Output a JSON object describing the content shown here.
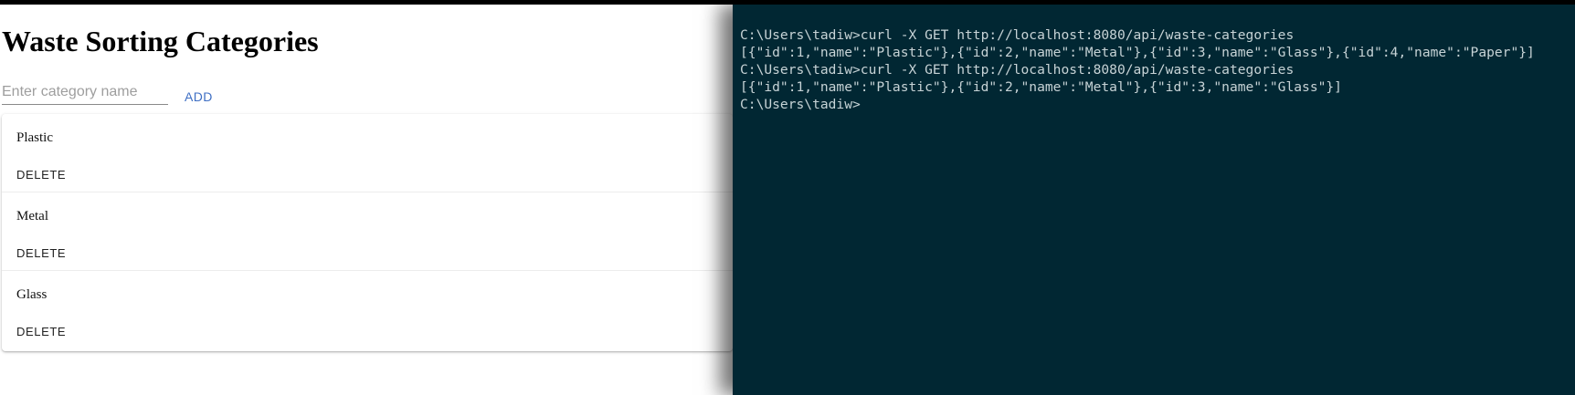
{
  "app": {
    "title": "Waste Sorting Categories",
    "input": {
      "placeholder": "Enter category name",
      "value": ""
    },
    "add_label": "ADD",
    "categories": [
      {
        "name": "Plastic",
        "delete_label": "DELETE"
      },
      {
        "name": "Metal",
        "delete_label": "DELETE"
      },
      {
        "name": "Glass",
        "delete_label": "DELETE"
      }
    ]
  },
  "terminal": {
    "lines": [
      "C:\\Users\\tadiw>curl -X GET http://localhost:8080/api/waste-categories",
      "[{\"id\":1,\"name\":\"Plastic\"},{\"id\":2,\"name\":\"Metal\"},{\"id\":3,\"name\":\"Glass\"},{\"id\":4,\"name\":\"Paper\"}]",
      "C:\\Users\\tadiw>curl -X GET http://localhost:8080/api/waste-categories",
      "[{\"id\":1,\"name\":\"Plastic\"},{\"id\":2,\"name\":\"Metal\"},{\"id\":3,\"name\":\"Glass\"}]",
      "C:\\Users\\tadiw>"
    ]
  },
  "colors": {
    "accent": "#3f6fc4",
    "terminal_background": "#012733",
    "terminal_text": "#c7d3d6"
  }
}
